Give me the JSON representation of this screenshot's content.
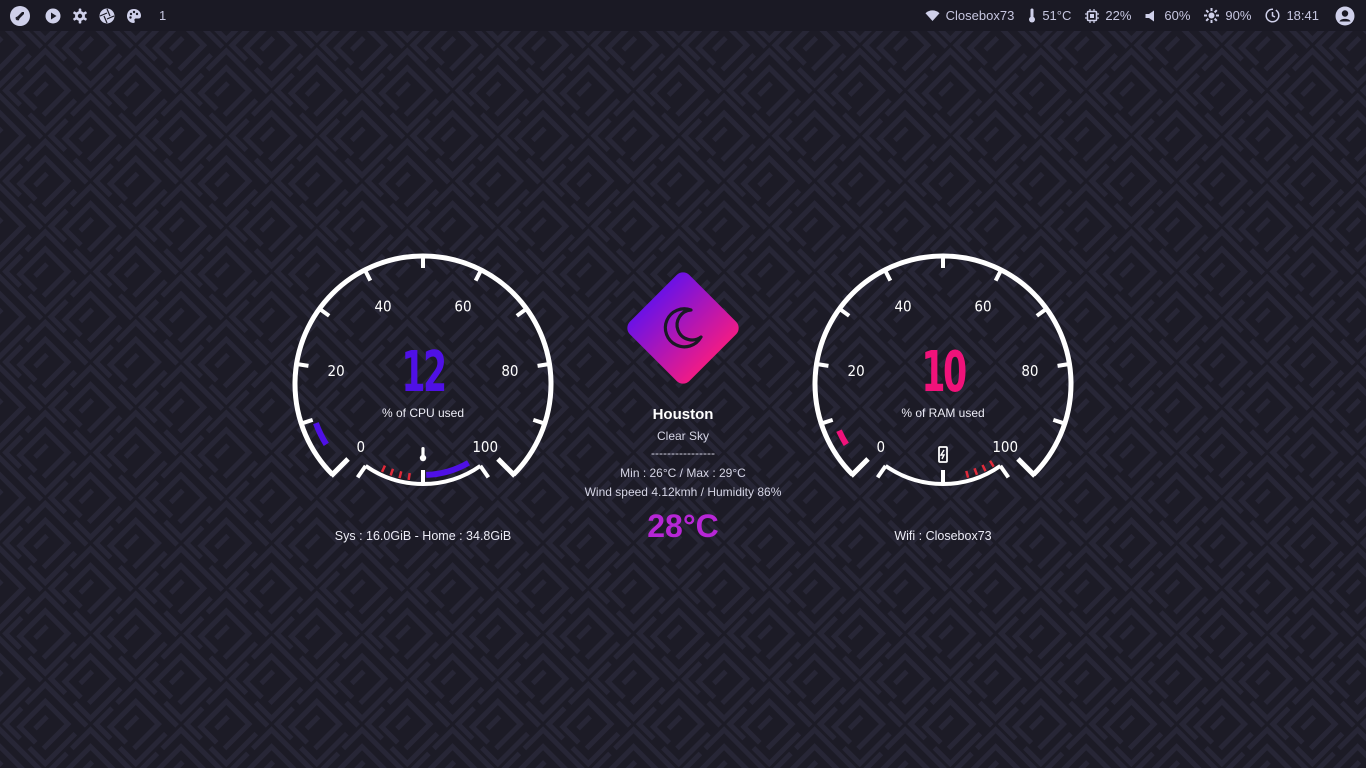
{
  "topbar": {
    "workspace": "1",
    "wifi_name": "Closebox73",
    "temperature": "51°C",
    "cpu": "22%",
    "volume": "60%",
    "brightness": "90%",
    "time": "18:41",
    "left_icons": [
      "rocket-icon",
      "play-icon",
      "settings-icon",
      "aperture-icon",
      "palette-icon"
    ],
    "right_icons": [
      "wifi-icon",
      "thermometer-icon",
      "cpu-icon",
      "volume-icon",
      "brightness-icon",
      "clock-icon",
      "user-icon"
    ]
  },
  "cpu_gauge": {
    "value": "12",
    "label": "% of CPU used",
    "ticks": [
      "0",
      "20",
      "40",
      "60",
      "80",
      "100"
    ],
    "level": 12,
    "caption": "Sys : 16.0GiB - Home : 34.8GiB",
    "accent": "#4f10e6",
    "icon": "thermometer-icon"
  },
  "ram_gauge": {
    "value": "10",
    "label": "% of RAM used",
    "ticks": [
      "0",
      "20",
      "40",
      "60",
      "80",
      "100"
    ],
    "level": 10,
    "caption": "Wifi : Closebox73",
    "accent": "#f0127a",
    "icon": "battery-icon"
  },
  "weather": {
    "city": "Houston",
    "condition": "Clear Sky",
    "separator": "----------------",
    "min_max": "Min : 26°C / Max : 29°C",
    "wind_humidity": "Wind speed 4.12kmh / Humidity 86%",
    "temperature": "28°C",
    "icon": "moon-icon",
    "gradient": [
      "#6b12e6",
      "#f01a86"
    ]
  },
  "colors": {
    "background": "#1c1b26",
    "pattern": "#262532",
    "gauge_ring": "#ffffff",
    "danger_tick": "#e02a3a"
  }
}
